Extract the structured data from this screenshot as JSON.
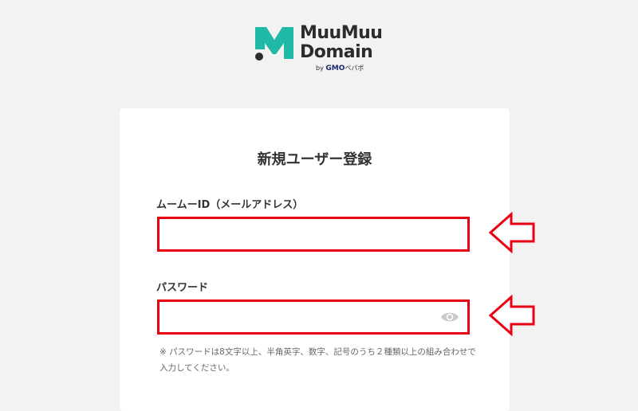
{
  "brand": {
    "line1": "MuuMuu",
    "line2": "Domain",
    "by_prefix": "by",
    "by_company": "GMO",
    "by_suffix": "ペパボ",
    "mark_color": "#1fb9a6",
    "dot_color": "#2c2c2c"
  },
  "form": {
    "title": "新規ユーザー登録",
    "id_label": "ムームーID（メールアドレス）",
    "id_value": "",
    "password_label": "パスワード",
    "password_value": "",
    "password_note": "※ パスワードは8文字以上、半角英字、数字、記号のうち２種類以上の組み合わせで入力してください。"
  },
  "annotations": {
    "highlight_color": "#e60012",
    "arrow_count": 2
  },
  "icons": {
    "toggle_password": "eye-icon"
  }
}
